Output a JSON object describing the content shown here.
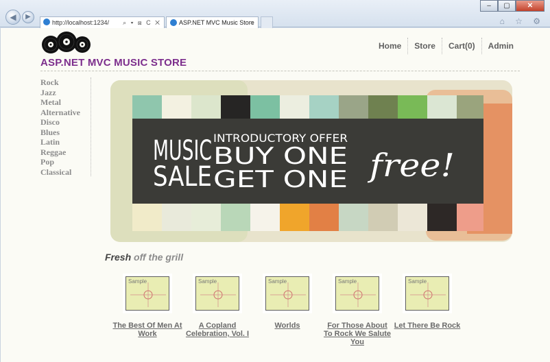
{
  "browser": {
    "address": "http://localhost:1234/",
    "tab_title": "ASP.NET MVC Music Store",
    "tab_close": "×",
    "addr_tools": "⌕ ▾ ⊠ C ✕",
    "window_buttons": [
      "–",
      "▢",
      "✕"
    ],
    "tool_icons": "⌂ ☆ ⚙"
  },
  "site": {
    "title": "ASP.NET MVC MUSIC STORE",
    "nav": [
      "Home",
      "Store",
      "Cart(0)",
      "Admin"
    ],
    "genres": [
      "Rock",
      "Jazz",
      "Metal",
      "Alternative",
      "Disco",
      "Blues",
      "Latin",
      "Reggae",
      "Pop",
      "Classical"
    ]
  },
  "banner": {
    "music": "MUSIC",
    "sale": "SALE",
    "intro": "INTRODUCTORY OFFER",
    "buy_one": "BUY ONE",
    "get_one": "GET ONE",
    "free": "free!"
  },
  "fresh": {
    "bold": "Fresh",
    "rest": "off the grill"
  },
  "albums": [
    {
      "placeholder": "Sample",
      "title": "The Best Of Men At Work"
    },
    {
      "placeholder": "Sample",
      "title": "A Copland Celebration, Vol. I"
    },
    {
      "placeholder": "Sample",
      "title": "Worlds"
    },
    {
      "placeholder": "Sample",
      "title": "For Those About To Rock We Salute You"
    },
    {
      "placeholder": "Sample",
      "title": "Let There Be Rock"
    }
  ],
  "colors": {
    "brand": "#7c2d8c",
    "banner_dark": "#3b3b37"
  }
}
